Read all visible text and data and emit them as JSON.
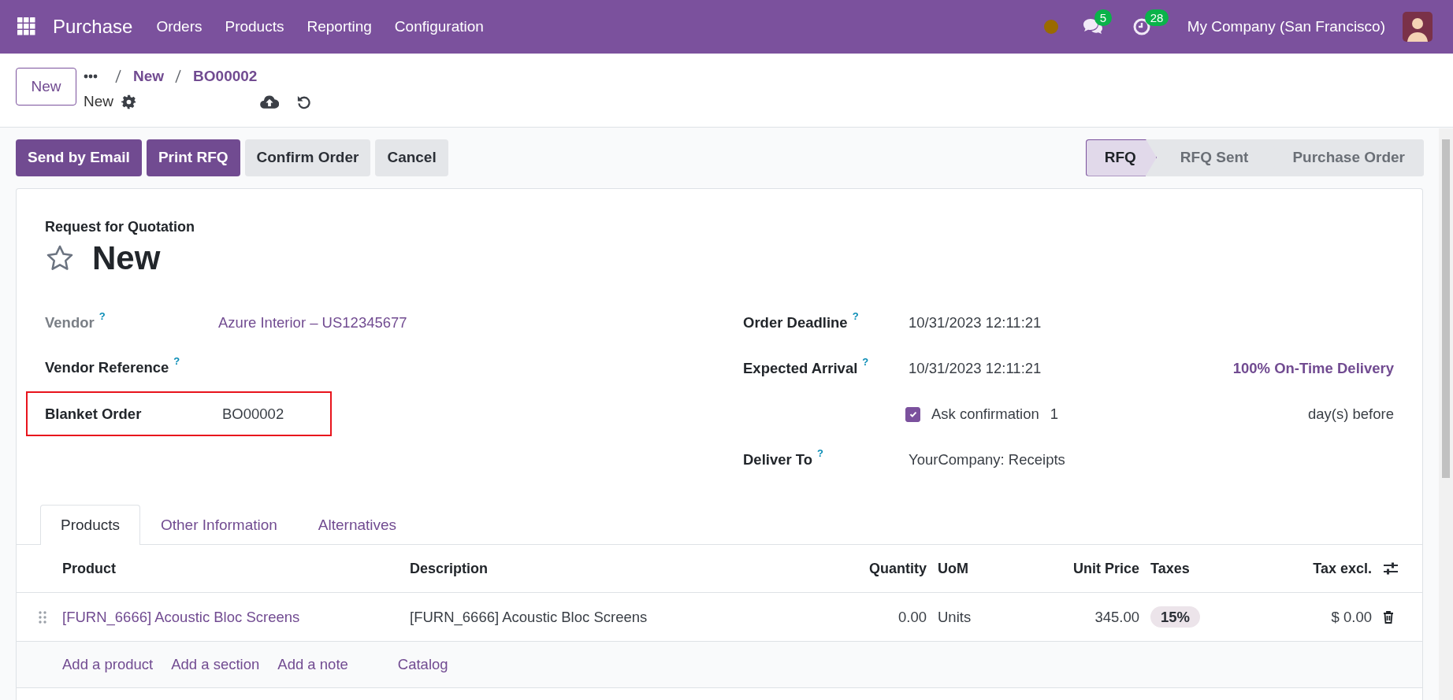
{
  "navbar": {
    "app_name": "Purchase",
    "menu": [
      "Orders",
      "Products",
      "Reporting",
      "Configuration"
    ],
    "chat_count": "5",
    "activity_count": "28",
    "company": "My Company (San Francisco)"
  },
  "control_panel": {
    "new_button": "New",
    "breadcrumbs": [
      "New",
      "BO00002"
    ],
    "record_name": "New"
  },
  "action_buttons": [
    {
      "label": "Send by Email",
      "kind": "primary"
    },
    {
      "label": "Print RFQ",
      "kind": "primary"
    },
    {
      "label": "Confirm Order",
      "kind": "secondary"
    },
    {
      "label": "Cancel",
      "kind": "secondary"
    }
  ],
  "statusbar": [
    {
      "label": "RFQ",
      "selected": true
    },
    {
      "label": "RFQ Sent",
      "selected": false
    },
    {
      "label": "Purchase Order",
      "selected": false
    }
  ],
  "form": {
    "subtitle": "Request for Quotation",
    "title": "New",
    "starred": false,
    "left_fields": [
      {
        "label": "Vendor",
        "help": "?",
        "value": "Azure Interior – US12345677",
        "kind": "link",
        "dimmed": true,
        "highlighted": false
      },
      {
        "label": "Vendor Reference",
        "help": "?",
        "kind": "empty",
        "dimmed": false,
        "highlighted": false
      },
      {
        "label": "Blanket Order",
        "value": "BO00002",
        "kind": "text",
        "dimmed": false,
        "highlighted": true
      }
    ],
    "right_fields": [
      {
        "label": "Order Deadline",
        "help": "?",
        "value": "10/31/2023 12:11:21"
      },
      {
        "label": "Expected Arrival",
        "help": "?",
        "value": "10/31/2023 12:11:21",
        "extra": "100% On-Time Delivery"
      }
    ],
    "ask_confirmation": {
      "checked": true,
      "label": "Ask confirmation",
      "days": "1",
      "suffix": "day(s) before"
    },
    "deliver_to": {
      "label": "Deliver To",
      "help": "?",
      "value": "YourCompany: Receipts"
    }
  },
  "tabs": [
    {
      "label": "Products",
      "selected": true
    },
    {
      "label": "Other Information",
      "selected": false
    },
    {
      "label": "Alternatives",
      "selected": false
    }
  ],
  "table": {
    "columns": [
      {
        "label": "Product",
        "kind": "text"
      },
      {
        "label": "Description",
        "kind": "text"
      },
      {
        "label": "Quantity",
        "kind": "number"
      },
      {
        "label": "UoM",
        "kind": "text"
      },
      {
        "label": "Unit Price",
        "kind": "number"
      },
      {
        "label": "Taxes",
        "kind": "text"
      },
      {
        "label": "Tax excl.",
        "kind": "number"
      }
    ],
    "rows": [
      {
        "product": "[FURN_6666] Acoustic Bloc Screens",
        "description": "[FURN_6666] Acoustic Bloc Screens",
        "quantity": "0.00",
        "uom": "Units",
        "unit_price": "345.00",
        "taxes": "15%",
        "tax_excl": "$ 0.00"
      }
    ],
    "add_links": [
      "Add a product",
      "Add a section",
      "Add a note",
      "Catalog"
    ]
  }
}
